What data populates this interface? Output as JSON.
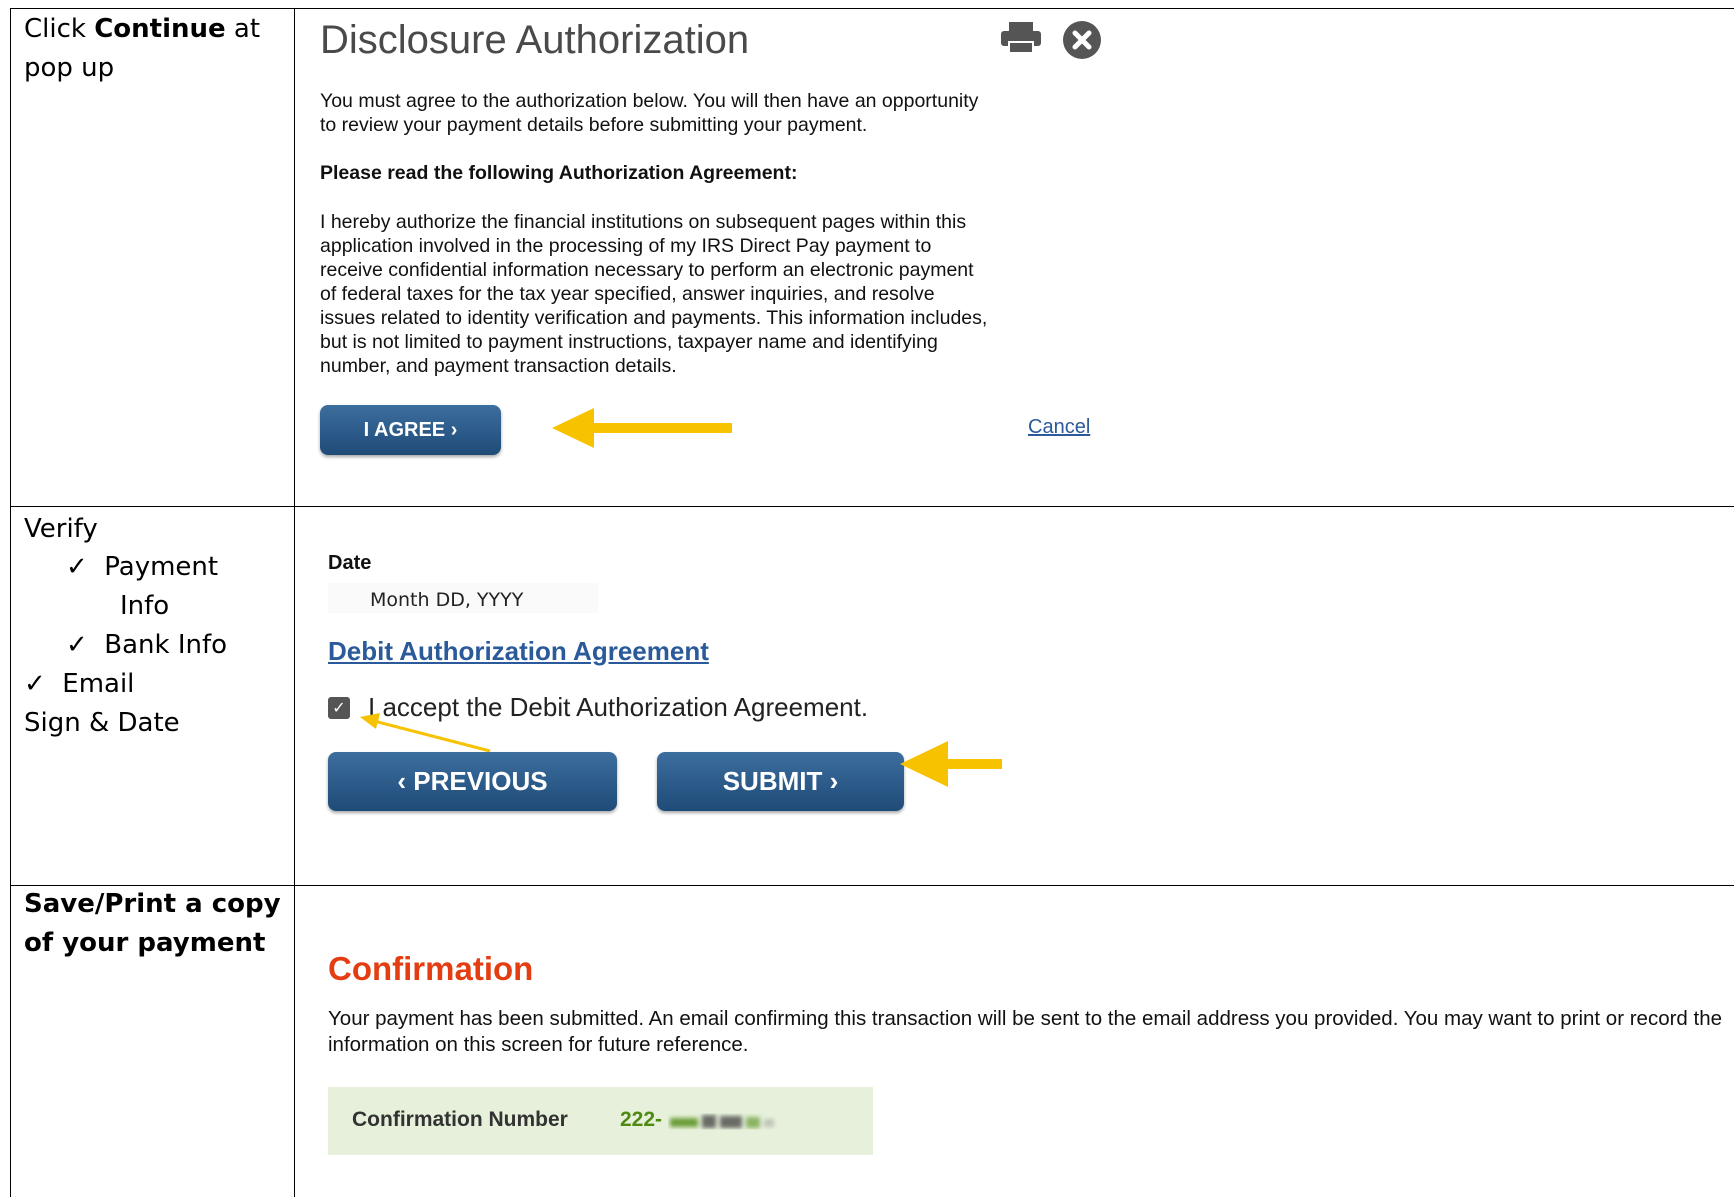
{
  "row1": {
    "instruction_pre": "Click ",
    "instruction_bold": "Continue",
    "instruction_post": " at",
    "instruction_line2": "pop up"
  },
  "dialog": {
    "title": "Disclosure Authorization",
    "intro_line1": "You must agree to the authorization below. You will then have an opportunity",
    "intro_line2": "to review your payment details before submitting your payment.",
    "heading": "Please read the following Authorization Agreement:",
    "agreement_lines": [
      "I hereby authorize the financial institutions on subsequent pages within this",
      "application involved in the processing of my IRS Direct Pay payment to",
      "receive confidential information necessary to perform an electronic payment",
      "of federal taxes for the tax year specified, answer inquiries, and resolve",
      "issues related to identity verification and payments. This information includes,",
      "but is not limited to payment instructions, taxpayer name and identifying",
      "number, and payment transaction details."
    ],
    "agree_label": "I AGREE ›",
    "cancel_label": "Cancel",
    "print_icon": "print-icon",
    "close_icon": "close-icon"
  },
  "row2": {
    "verify": "Verify",
    "check1a": "Payment",
    "check1b": "Info",
    "check2": "Bank Info",
    "check3": "Email",
    "sign": "Sign & Date",
    "date_label": "Date",
    "date_value": "Month DD, YYYY",
    "debit_link": "Debit Authorization Agreement",
    "accept_text": "I accept the Debit Authorization Agreement.",
    "previous_label": "‹  PREVIOUS",
    "submit_label": "SUBMIT  ›"
  },
  "row3": {
    "instruction_line1": "Save/Print a copy",
    "instruction_line2": "of your payment",
    "conf_title": "Confirmation",
    "conf_text": "Your payment has been submitted. An email confirming this transaction will be sent to the email address you provided. You may want to print or record the information on this screen for future reference.",
    "conf_label": "Confirmation Number",
    "conf_number": "222-"
  },
  "colors": {
    "arrow": "#f7c200",
    "button": "#2c5a88",
    "confirmation": "#e43d12",
    "link": "#2a5a9a"
  }
}
